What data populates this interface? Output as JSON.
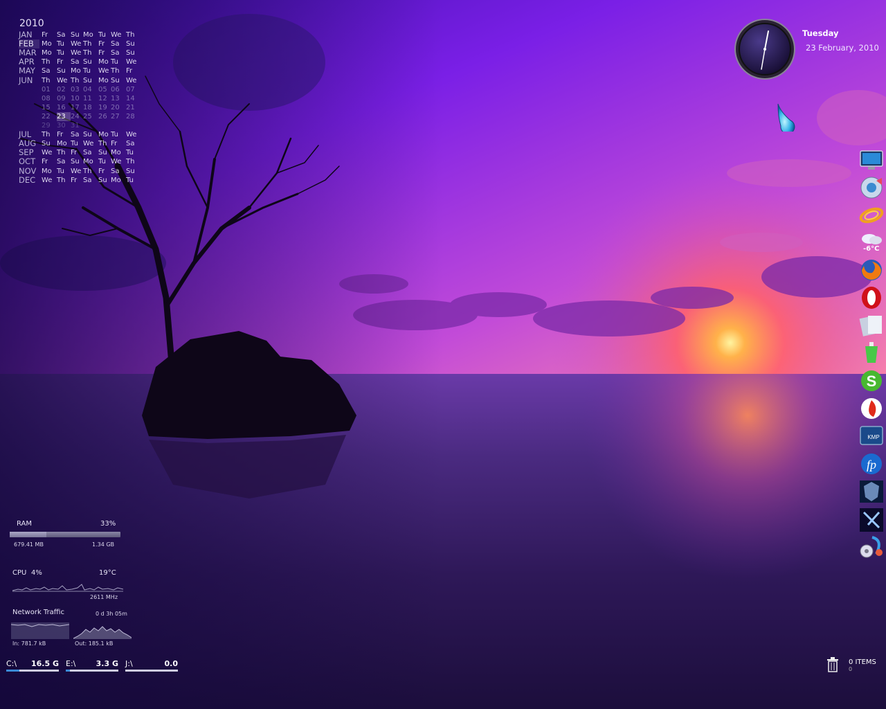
{
  "calendar": {
    "year": "2010",
    "months_top": [
      {
        "name": "JAN",
        "days": [
          "Fr",
          "Sa",
          "Su",
          "Mo",
          "Tu",
          "We",
          "Th"
        ]
      },
      {
        "name": "FEB",
        "days": [
          "Mo",
          "Tu",
          "We",
          "Th",
          "Fr",
          "Sa",
          "Su"
        ],
        "current": true
      },
      {
        "name": "MAR",
        "days": [
          "Mo",
          "Tu",
          "We",
          "Th",
          "Fr",
          "Sa",
          "Su"
        ]
      },
      {
        "name": "APR",
        "days": [
          "Th",
          "Fr",
          "Sa",
          "Su",
          "Mo",
          "Tu",
          "We"
        ]
      },
      {
        "name": "MAY",
        "days": [
          "Sa",
          "Su",
          "Mo",
          "Tu",
          "We",
          "Th",
          "Fr"
        ]
      },
      {
        "name": "JUN",
        "days": [
          "Th",
          "We",
          "Th",
          "Su",
          "Mo",
          "Su",
          "We"
        ]
      }
    ],
    "date_rows": [
      [
        "01",
        "02",
        "03",
        "04",
        "05",
        "06",
        "07"
      ],
      [
        "08",
        "09",
        "10",
        "11",
        "12",
        "13",
        "14"
      ],
      [
        "15",
        "16",
        "17",
        "18",
        "19",
        "20",
        "21"
      ],
      [
        "22",
        "23",
        "24",
        "25",
        "26",
        "27",
        "28"
      ],
      [
        "29",
        "30",
        "31",
        "",
        "",
        "",
        "",
        ""
      ]
    ],
    "today": "23",
    "months_bottom": [
      {
        "name": "JUL",
        "days": [
          "Th",
          "Fr",
          "Sa",
          "Su",
          "Mo",
          "Tu",
          "We"
        ]
      },
      {
        "name": "AUG",
        "days": [
          "Su",
          "Mo",
          "Tu",
          "We",
          "Th",
          "Fr",
          "Sa"
        ]
      },
      {
        "name": "SEP",
        "days": [
          "We",
          "Th",
          "Fr",
          "Sa",
          "Su",
          "Mo",
          "Tu"
        ]
      },
      {
        "name": "OCT",
        "days": [
          "Fr",
          "Sa",
          "Su",
          "Mo",
          "Tu",
          "We",
          "Th"
        ]
      },
      {
        "name": "NOV",
        "days": [
          "Mo",
          "Tu",
          "We",
          "Th",
          "Fr",
          "Sa",
          "Su"
        ]
      },
      {
        "name": "DEC",
        "days": [
          "We",
          "Th",
          "Fr",
          "Sa",
          "Su",
          "Mo",
          "Tu"
        ]
      }
    ]
  },
  "clock": {
    "day": "Tuesday",
    "date": "23 February, 2010"
  },
  "dock": {
    "weather_temp": "-6°C",
    "icons": [
      "monitor-icon",
      "media-player-icon",
      "orbit-icon",
      "weather-icon",
      "firefox-icon",
      "opera-icon",
      "documents-icon",
      "cleaner-icon",
      "skype-icon",
      "flash-icon",
      "kmplayer-icon",
      "fp-icon",
      "shield-icon",
      "tool-icon",
      "settings-icon"
    ]
  },
  "ram": {
    "label": "RAM",
    "percent": "33%",
    "used": "679.41 MB",
    "total": "1.34 GB",
    "fill_fraction": 0.33
  },
  "cpu": {
    "label": "CPU",
    "percent": "4%",
    "temp": "19°C",
    "freq": "2611 MHz"
  },
  "network": {
    "label": "Network Traffic",
    "uptime": "0 d 3h 05m",
    "in": "In: 781.7 kB",
    "out": "Out: 185.1 kB"
  },
  "drives": [
    {
      "label": "C:\\",
      "size": "16.5 G",
      "used_fraction": 0.25
    },
    {
      "label": "E:\\",
      "size": "3.3 G",
      "used_fraction": 0.08
    },
    {
      "label": "J:\\",
      "size": "0.0",
      "used_fraction": 0.0
    }
  ],
  "recycle": {
    "items": "0 ITEMS",
    "size": "0"
  },
  "colors": {
    "sky_top": "#5a1ecf",
    "sky_mid": "#b54ad6",
    "horizon": "#ff6a3a",
    "water": "#3c1a66",
    "drive_fill": "#3a8ad6"
  }
}
